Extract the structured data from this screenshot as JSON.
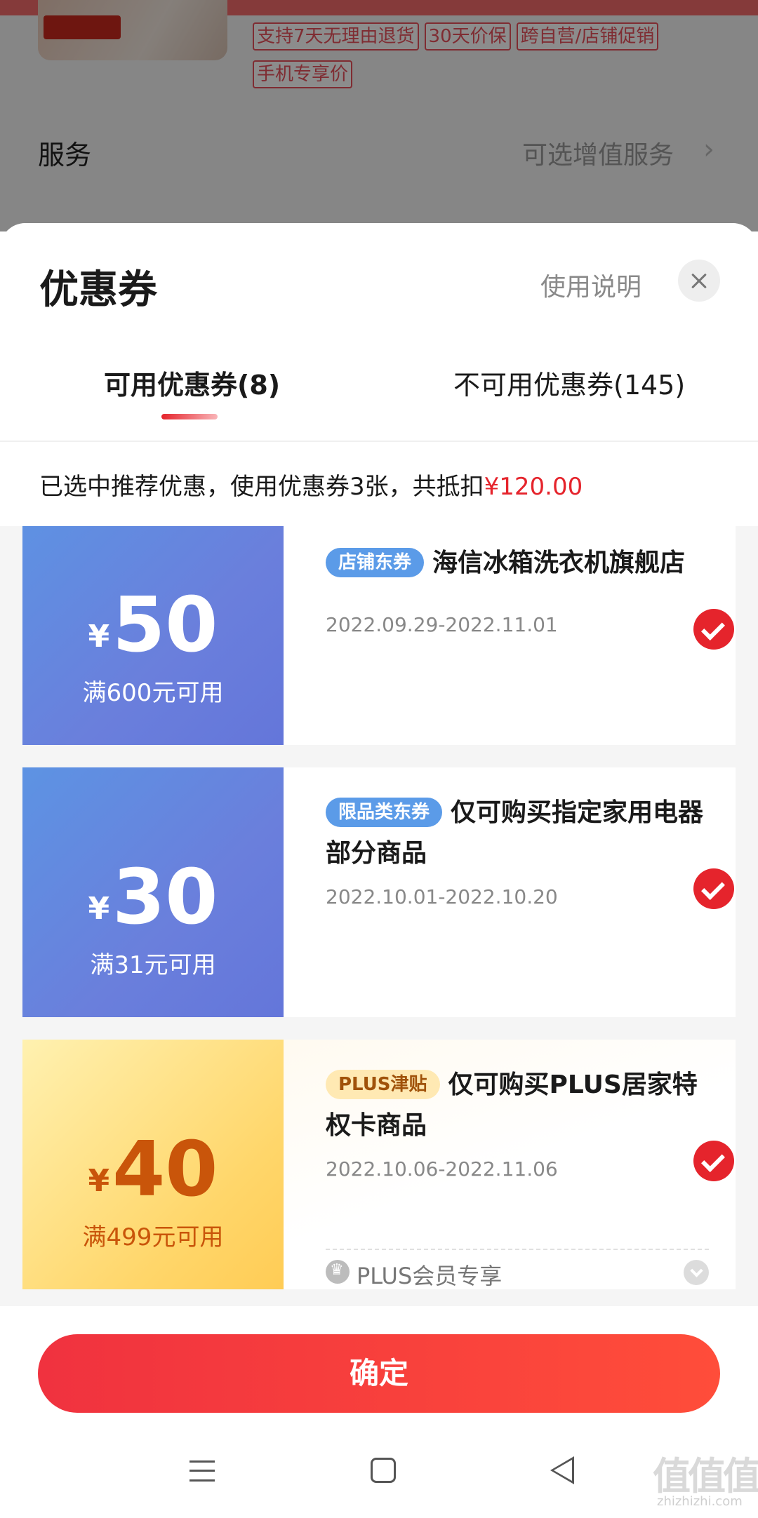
{
  "background": {
    "tags": [
      "支持7天无理由退货",
      "30天价保",
      "跨自营/店铺促销",
      "手机专享价"
    ],
    "service_label": "服务",
    "service_value": "可选增值服务",
    "service_chevron": "›"
  },
  "sheet": {
    "title": "优惠券",
    "help_link": "使用说明"
  },
  "tabs": {
    "available": "可用优惠券(8)",
    "unavailable": "不可用优惠券(145)"
  },
  "summary": {
    "text": "已选中推荐优惠，使用优惠券3张，共抵扣",
    "amount": "¥120.00"
  },
  "coupons": [
    {
      "currency": "¥",
      "amount": "50",
      "threshold": "满600元可用",
      "badge": "店铺东券",
      "title": "海信冰箱洗衣机旗舰店",
      "date": "2022.09.29-2022.11.01",
      "selected": true
    },
    {
      "currency": "¥",
      "amount": "30",
      "threshold": "满31元可用",
      "badge": "限品类东券",
      "title": "仅可购买指定家用电器部分商品",
      "date": "2022.10.01-2022.10.20",
      "selected": true
    },
    {
      "currency": "¥",
      "amount": "40",
      "threshold": "满499元可用",
      "badge": "PLUS津贴",
      "title": "仅可购买PLUS居家特权卡商品",
      "date": "2022.10.06-2022.11.06",
      "selected": true,
      "footer": "PLUS会员专享"
    }
  ],
  "confirm_label": "确定",
  "watermark": {
    "text": "值值值",
    "url": "zhizhizhi.com"
  },
  "colors": {
    "accent_red": "#e5242c",
    "coupon_blue": "#6a84dd",
    "coupon_gold": "#ffd66a"
  }
}
